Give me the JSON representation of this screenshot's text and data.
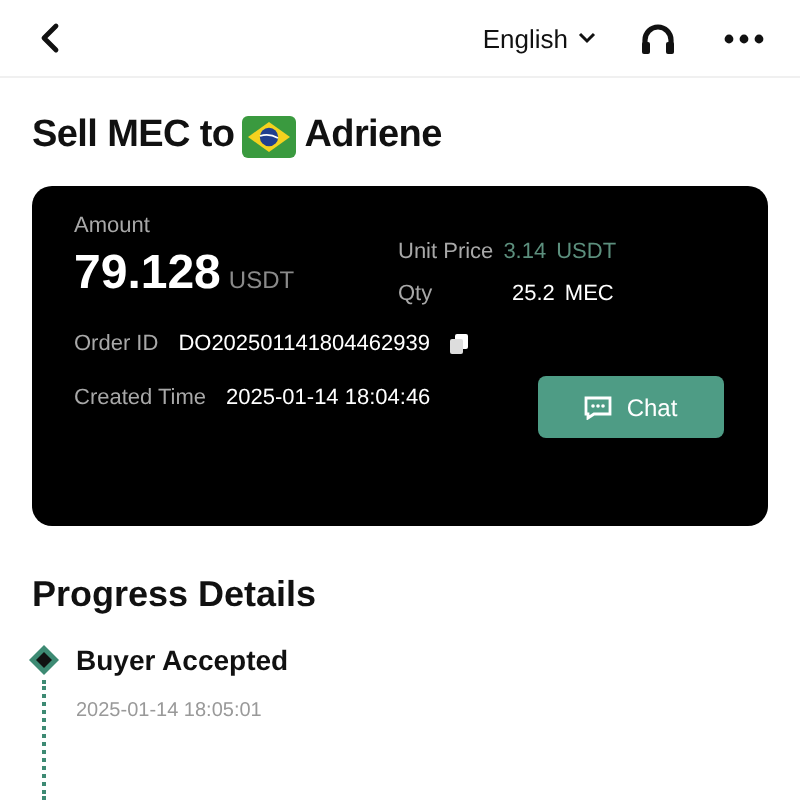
{
  "header": {
    "language": "English"
  },
  "title": {
    "prefix": "Sell MEC to",
    "name": "Adriene"
  },
  "order": {
    "amount_label": "Amount",
    "amount": "79.128",
    "amount_unit": "USDT",
    "unit_price_label": "Unit Price",
    "unit_price": "3.14",
    "unit_price_unit": "USDT",
    "qty_label": "Qty",
    "qty": "25.2",
    "qty_unit": "MEC",
    "order_id_label": "Order ID",
    "order_id": "DO202501141804462939",
    "created_label": "Created Time",
    "created": "2025-01-14 18:04:46",
    "chat_button": "Chat"
  },
  "progress": {
    "title": "Progress Details",
    "steps": [
      {
        "title": "Buyer Accepted",
        "time": "2025-01-14 18:05:01"
      }
    ]
  }
}
